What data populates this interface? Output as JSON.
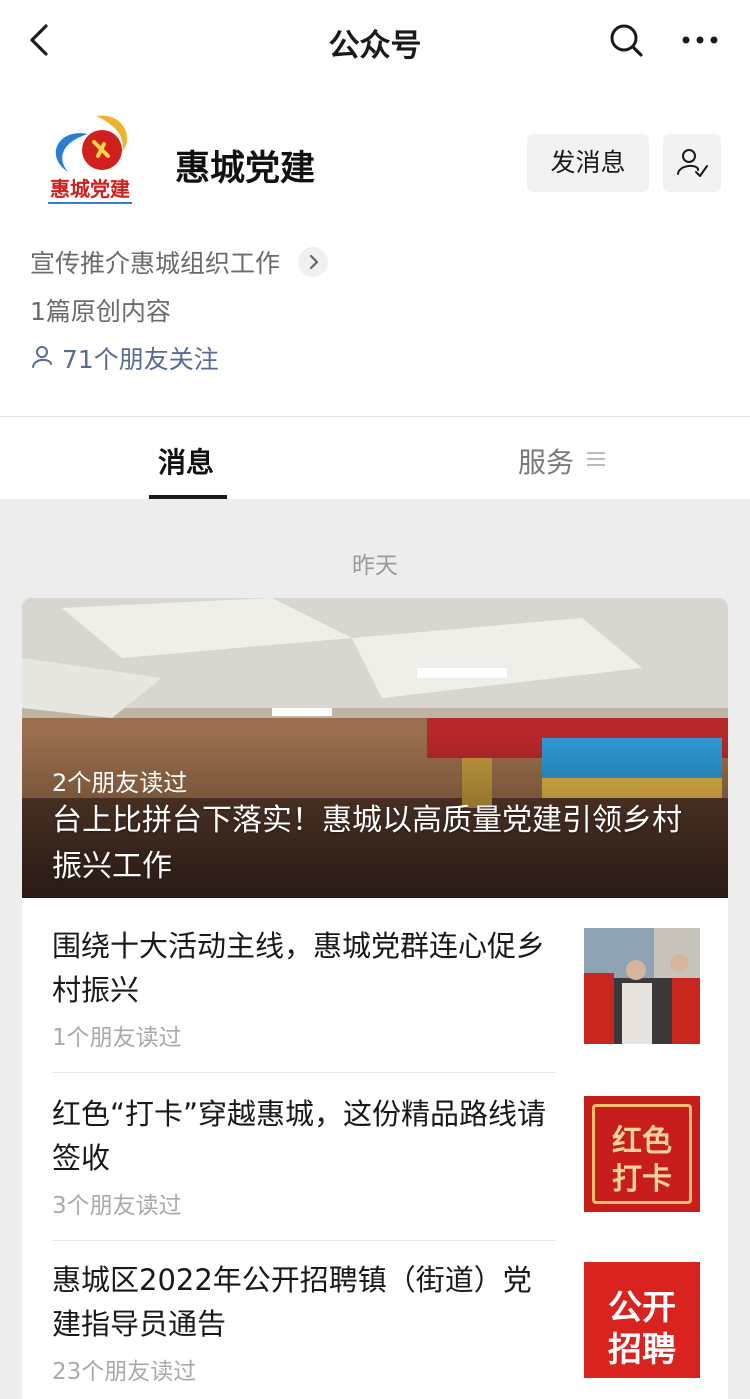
{
  "nav": {
    "title": "公众号",
    "back_icon": "chevron-left-icon",
    "search_icon": "search-icon",
    "more_icon": "more-icon"
  },
  "profile": {
    "name": "惠城党建",
    "logo_text": "惠城党建",
    "send_message": "发消息",
    "intro": "宣传推介惠城组织工作",
    "original": "1篇原创内容",
    "friends_follow": "71个朋友关注"
  },
  "tabs": {
    "messages": "消息",
    "services": "服务"
  },
  "feed": {
    "date": "昨天",
    "hero": {
      "read": "2个朋友读过",
      "title": "台上比拼台下落实！惠城以高质量党建引领乡村振兴工作"
    },
    "items": [
      {
        "title": "围绕十大活动主线，惠城党群连心促乡村振兴",
        "read": "1个朋友读过",
        "thumb_text": ""
      },
      {
        "title": "红色“打卡”穿越惠城，这份精品路线请签收",
        "read": "3个朋友读过",
        "thumb_text": "红色打卡",
        "thumb_line1": "红色",
        "thumb_line2": "打卡"
      },
      {
        "title": "惠城区2022年公开招聘镇（街道）党建指导员通告",
        "read": "23个朋友读过",
        "thumb_text": "公开招聘",
        "thumb_line1": "公开",
        "thumb_line2": "招聘"
      }
    ]
  },
  "colors": {
    "link": "#576b95",
    "party_red": "#d0201e",
    "background": "#ededed"
  }
}
